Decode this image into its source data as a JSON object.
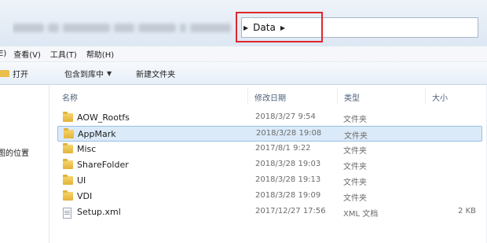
{
  "address": {
    "current_folder": "Data",
    "highlight_color": "#e0262c"
  },
  "menu": [
    "E)",
    "查看(V)",
    "工具(T)",
    "帮助(H)"
  ],
  "toolbar": {
    "open_label": "打开",
    "include_library_label": "包含到库中",
    "new_folder_label": "新建文件夹"
  },
  "nav": {
    "recent_label": "图的位置"
  },
  "columns": {
    "name": "名称",
    "date": "修改日期",
    "type": "类型",
    "size": "大小"
  },
  "files": [
    {
      "name": "AOW_Rootfs",
      "date": "2018/3/27 9:54",
      "type": "文件夹",
      "size": "",
      "icon": "folder-icon",
      "selected": false
    },
    {
      "name": "AppMark",
      "date": "2018/3/28 19:08",
      "type": "文件夹",
      "size": "",
      "icon": "folder-icon",
      "selected": true
    },
    {
      "name": "Misc",
      "date": "2017/8/1 9:22",
      "type": "文件夹",
      "size": "",
      "icon": "folder-icon",
      "selected": false
    },
    {
      "name": "ShareFolder",
      "date": "2018/3/28 19:03",
      "type": "文件夹",
      "size": "",
      "icon": "folder-icon",
      "selected": false
    },
    {
      "name": "UI",
      "date": "2018/3/28 19:13",
      "type": "文件夹",
      "size": "",
      "icon": "folder-icon",
      "selected": false
    },
    {
      "name": "VDI",
      "date": "2018/3/28 19:09",
      "type": "文件夹",
      "size": "",
      "icon": "folder-icon",
      "selected": false
    },
    {
      "name": "Setup.xml",
      "date": "2017/12/27 17:56",
      "type": "XML 文档",
      "size": "2 KB",
      "icon": "xml-document-icon",
      "selected": false
    }
  ]
}
